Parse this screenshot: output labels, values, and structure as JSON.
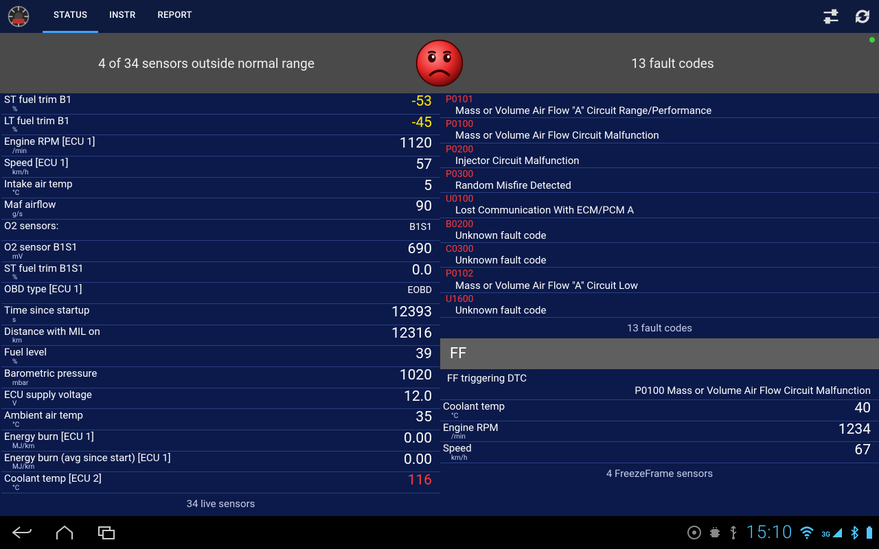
{
  "tabs": {
    "status": "STATUS",
    "instr": "INSTR",
    "report": "REPORT"
  },
  "summary": {
    "left": "4 of 34 sensors outside normal range",
    "right": "13 fault codes"
  },
  "sensors": [
    {
      "label": "ST fuel trim B1",
      "unit": "%",
      "value": "-53",
      "style": "bad"
    },
    {
      "label": "LT fuel trim B1",
      "unit": "%",
      "value": "-45",
      "style": "bad"
    },
    {
      "label": "Engine RPM [ECU 1]",
      "unit": "/min",
      "value": "1120"
    },
    {
      "label": "Speed [ECU 1]",
      "unit": "km/h",
      "value": "57"
    },
    {
      "label": "Intake air temp",
      "unit": "°C",
      "value": "5"
    },
    {
      "label": "Maf airflow",
      "unit": "g/s",
      "value": "90"
    },
    {
      "label": "O2 sensors:",
      "unit": "",
      "value": "B1S1",
      "style": "small"
    },
    {
      "label": "O2 sensor B1S1",
      "unit": "mV",
      "value": "690"
    },
    {
      "label": "ST fuel trim B1S1",
      "unit": "%",
      "value": "0.0"
    },
    {
      "label": "OBD type [ECU 1]",
      "unit": "",
      "value": "EOBD",
      "style": "small"
    },
    {
      "label": "Time since startup",
      "unit": "s",
      "value": "12393"
    },
    {
      "label": "Distance with MIL on",
      "unit": "km",
      "value": "12316"
    },
    {
      "label": "Fuel level",
      "unit": "%",
      "value": "39"
    },
    {
      "label": "Barometric pressure",
      "unit": "mbar",
      "value": "1020"
    },
    {
      "label": "ECU supply voltage",
      "unit": "V",
      "value": "12.0"
    },
    {
      "label": "Ambient air temp",
      "unit": "°C",
      "value": "35"
    },
    {
      "label": "Energy burn [ECU 1]",
      "unit": "MJ/km",
      "value": "0.00"
    },
    {
      "label": "Energy burn (avg since start) [ECU 1]",
      "unit": "MJ/km",
      "value": "0.00"
    },
    {
      "label": "Coolant temp [ECU 2]",
      "unit": "°C",
      "value": "116",
      "style": "red"
    }
  ],
  "sensors_footer": "34 live sensors",
  "faults": [
    {
      "code": "P0101",
      "desc": "Mass or Volume Air Flow \"A\" Circuit Range/Performance"
    },
    {
      "code": "P0100",
      "desc": "Mass or Volume Air Flow Circuit Malfunction"
    },
    {
      "code": "P0200",
      "desc": "Injector Circuit Malfunction"
    },
    {
      "code": "P0300",
      "desc": "Random Misfire Detected"
    },
    {
      "code": "U0100",
      "desc": "Lost Communication With ECM/PCM A"
    },
    {
      "code": "B0200",
      "desc": "Unknown fault code"
    },
    {
      "code": "C0300",
      "desc": "Unknown fault code"
    },
    {
      "code": "P0102",
      "desc": "Mass or Volume Air Flow \"A\" Circuit Low"
    },
    {
      "code": "U1600",
      "desc": "Unknown fault code"
    }
  ],
  "faults_footer": "13 fault codes",
  "ff": {
    "header": "FF",
    "trig_label": "FF triggering DTC",
    "trig_value": "P0100 Mass or Volume Air Flow Circuit Malfunction",
    "sensors": [
      {
        "label": "Coolant temp",
        "unit": "°C",
        "value": "40"
      },
      {
        "label": "Engine RPM",
        "unit": "/min",
        "value": "1234"
      },
      {
        "label": "Speed",
        "unit": "km/h",
        "value": "67"
      }
    ],
    "footer": "4 FreezeFrame sensors"
  },
  "clock": "15:10",
  "net": "3G"
}
